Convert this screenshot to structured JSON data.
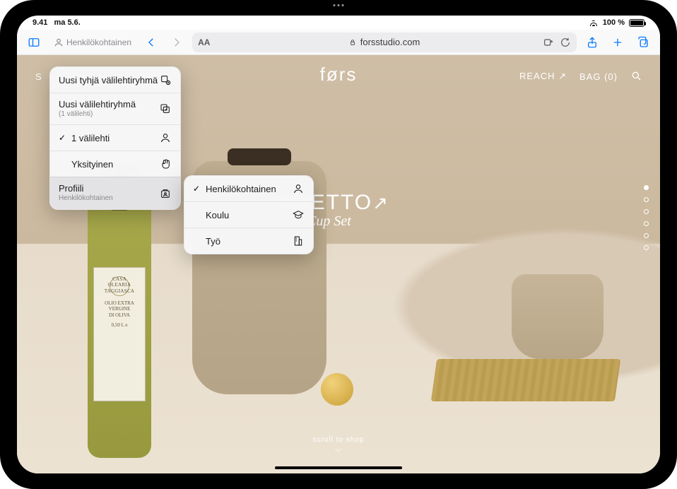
{
  "status": {
    "time": "9.41",
    "date": "ma 5.6.",
    "battery_pct": "100 %"
  },
  "toolbar": {
    "profile_label": "Henkilökohtainen",
    "aa_button": "AA",
    "url_host": "forsstudio.com"
  },
  "tab_menu": {
    "new_empty_group": "Uusi tyhjä välilehtiryhmä",
    "new_group_from": "Uusi välilehtiryhmä",
    "new_group_from_sub": "(1 välilehti)",
    "one_tab": "1 välilehti",
    "private": "Yksityinen",
    "profile": "Profiili",
    "profile_sub": "Henkilökohtainen"
  },
  "profile_menu": {
    "items": [
      {
        "label": "Henkilökohtainen",
        "checked": true,
        "icon": "person"
      },
      {
        "label": "Koulu",
        "checked": false,
        "icon": "grad"
      },
      {
        "label": "Työ",
        "checked": false,
        "icon": "building"
      }
    ]
  },
  "site": {
    "leftnav": "S",
    "brand": "førs",
    "reach": "REACH",
    "bag": "BAG (0)",
    "hero_line1": "ARETTO",
    "hero_line2": "fe & Cup Set",
    "scroll_hint": "scroll to shop"
  },
  "bottle_label": {
    "brand": "CASA OLEARIA TAGGIASCA",
    "line1": "OLIO EXTRA",
    "line2": "VERGINE",
    "line3": "DI OLIVA",
    "vol": "0,50 L e"
  }
}
